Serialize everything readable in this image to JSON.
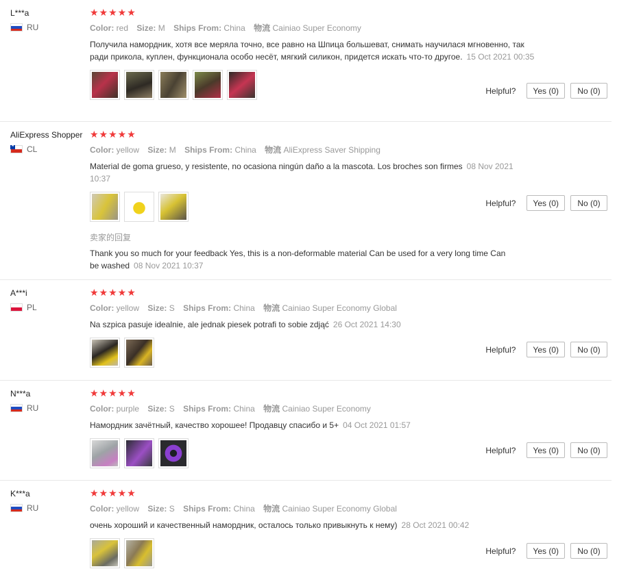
{
  "labels": {
    "color": "Color:",
    "size": "Size:",
    "ships_from": "Ships From:",
    "logistics": "物流",
    "helpful": "Helpful?"
  },
  "reviews": [
    {
      "user": "L***a",
      "country": "RU",
      "stars": "★★★★★",
      "color": "red",
      "size": "M",
      "ships_from": "China",
      "logistics": "Cainiao Super Economy",
      "text": "Получила намордник, хотя все меряла точно, все равно на Шпица большеват, снимать научилася мгновенно, так ради прикола, куплен, функционала особо несёт, мягкий силикон, придется искать что-то другое.",
      "date": "15 Oct 2021 00:35",
      "yes": "Yes (0)",
      "no": "No (0)"
    },
    {
      "user": "AliExpress Shopper",
      "country": "CL",
      "stars": "★★★★★",
      "color": "yellow",
      "size": "M",
      "ships_from": "China",
      "logistics": "AliExpress Saver Shipping",
      "text": "Material de goma grueso, y resistente, no ocasiona ningún daño a la mascota. Los broches son firmes",
      "date": "08 Nov 2021 10:37",
      "yes": "Yes (0)",
      "no": "No (0)",
      "seller_reply_title": "卖家的回复",
      "seller_reply": "Thank you so much for your feedback Yes, this is a non-deformable material Can be used for a very long time Can be washed",
      "seller_reply_date": "08 Nov 2021 10:37"
    },
    {
      "user": "A***i",
      "country": "PL",
      "stars": "★★★★★",
      "color": "yellow",
      "size": "S",
      "ships_from": "China",
      "logistics": "Cainiao Super Economy Global",
      "text": "Na szpica pasuje idealnie, ale jednak piesek potrafi to sobie zdjąć",
      "date": "26 Oct 2021 14:30",
      "yes": "Yes (0)",
      "no": "No (0)"
    },
    {
      "user": "N***a",
      "country": "RU",
      "stars": "★★★★★",
      "color": "purple",
      "size": "S",
      "ships_from": "China",
      "logistics": "Cainiao Super Economy",
      "text": "Намордник зачётный, качество хорошее! Продавцу спасибо и 5+",
      "date": "04 Oct 2021 01:57",
      "yes": "Yes (0)",
      "no": "No (0)"
    },
    {
      "user": "K***a",
      "country": "RU",
      "stars": "★★★★★",
      "color": "yellow",
      "size": "S",
      "ships_from": "China",
      "logistics": "Cainiao Super Economy Global",
      "text": "очень хороший и качественный намордник, осталось только привыкнуть к нему)",
      "date": "28 Oct 2021 00:42",
      "yes": "Yes (0)",
      "no": "No (0)"
    }
  ],
  "colors": {
    "star": "#f03a3a",
    "muted": "#999999",
    "text": "#333333",
    "divider": "#e8e8e8"
  }
}
